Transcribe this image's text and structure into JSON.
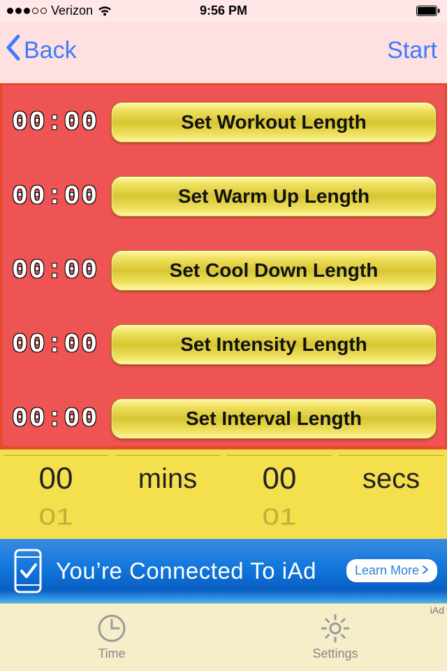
{
  "status": {
    "carrier": "Verizon",
    "time": "9:56 PM"
  },
  "nav": {
    "back_label": "Back",
    "start_label": "Start"
  },
  "rows": [
    {
      "time": "00:00",
      "button": "Set Workout Length"
    },
    {
      "time": "00:00",
      "button": "Set Warm Up Length"
    },
    {
      "time": "00:00",
      "button": "Set Cool Down Length"
    },
    {
      "time": "00:00",
      "button": "Set Intensity Length"
    },
    {
      "time": "00:00",
      "button": "Set Interval Length"
    }
  ],
  "picker": {
    "mins_value": "00",
    "mins_next": "01",
    "mins_label": "mins",
    "secs_value": "00",
    "secs_next": "01",
    "secs_label": "secs"
  },
  "ad": {
    "text": "You’re Connected To iAd",
    "learn_more": "Learn More",
    "tag": "iAd"
  },
  "tabs": {
    "time": "Time",
    "settings": "Settings"
  }
}
